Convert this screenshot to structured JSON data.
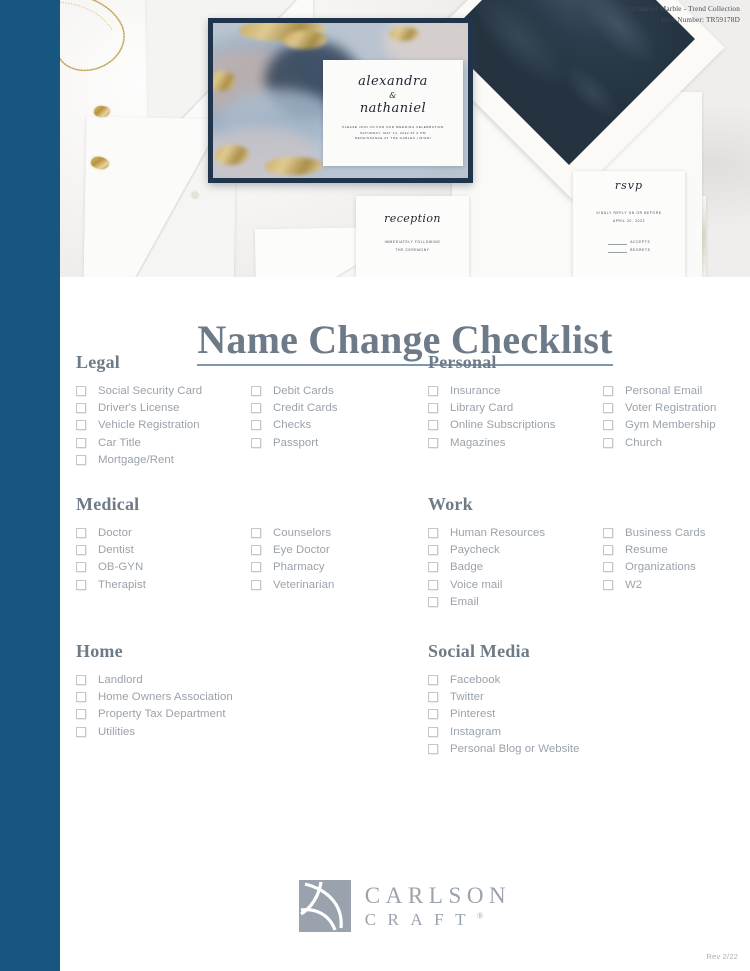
{
  "header": {
    "collection_line": "Enchanted Marble - Trend Collection",
    "item_number_line": "Item Number: TR59178D"
  },
  "page_title": "Name Change Checklist",
  "hero": {
    "invitation": {
      "name_first": "alexandra",
      "ampersand": "&",
      "name_second": "nathaniel",
      "line1": "PLEASE JOIN US FOR OUR WEDDING CELEBRATION",
      "line2": "SATURDAY, MAY 14, 2022 AT 6 PM",
      "line3": "RENAISSANCE AT THE GABLES | MIAMI"
    },
    "reception_card": {
      "script": "reception",
      "line1": "IMMEDIATELY FOLLOWING",
      "line2": "THE CEREMONY"
    },
    "rsvp_card": {
      "script": "rsvp",
      "line1": "KINDLY REPLY ON OR BEFORE",
      "line2": "APRIL 20, 2022",
      "option1": "ACCEPTS",
      "option2": "REGRETS"
    }
  },
  "sections": {
    "legal": {
      "heading": "Legal",
      "col1": [
        "Social Security Card",
        "Driver's License",
        "Vehicle Registration",
        "Car Title",
        "Mortgage/Rent"
      ],
      "col2": [
        "Debit Cards",
        "Credit Cards",
        "Checks",
        "Passport"
      ]
    },
    "personal": {
      "heading": "Personal",
      "col1": [
        "Insurance",
        "Library Card",
        "Online Subscriptions",
        "Magazines"
      ],
      "col2": [
        "Personal Email",
        "Voter Registration",
        "Gym Membership",
        "Church"
      ]
    },
    "medical": {
      "heading": "Medical",
      "col1": [
        "Doctor",
        "Dentist",
        "OB-GYN",
        "Therapist"
      ],
      "col2": [
        "Counselors",
        "Eye Doctor",
        "Pharmacy",
        "Veterinarian"
      ]
    },
    "work": {
      "heading": "Work",
      "col1": [
        "Human Resources",
        "Paycheck",
        "Badge",
        "Voice mail",
        "Email"
      ],
      "col2": [
        "Business Cards",
        "Resume",
        "Organizations",
        "W2"
      ]
    },
    "home": {
      "heading": "Home",
      "col1": [
        "Landlord",
        "Home Owners Association",
        "Property Tax Department",
        "Utilities"
      ],
      "col2": []
    },
    "social_media": {
      "heading": "Social Media",
      "col1": [
        "Facebook",
        "Twitter",
        "Pinterest",
        "Instagram",
        "Personal Blog or Website"
      ],
      "col2": []
    }
  },
  "footer": {
    "logo_line1": "CARLSON",
    "logo_line2": "CRAFT",
    "logo_trademark": "®",
    "revision": "Rev 2/22"
  },
  "colors": {
    "rail_blue": "#165681",
    "title_slate": "#6d7b88",
    "title_rule": "#7d97b0",
    "item_gray": "#9aa2aa",
    "checkbox_border": "#c2c7cd",
    "logo_gray": "#9aa3ad",
    "invite_frame_navy": "#20344c"
  }
}
